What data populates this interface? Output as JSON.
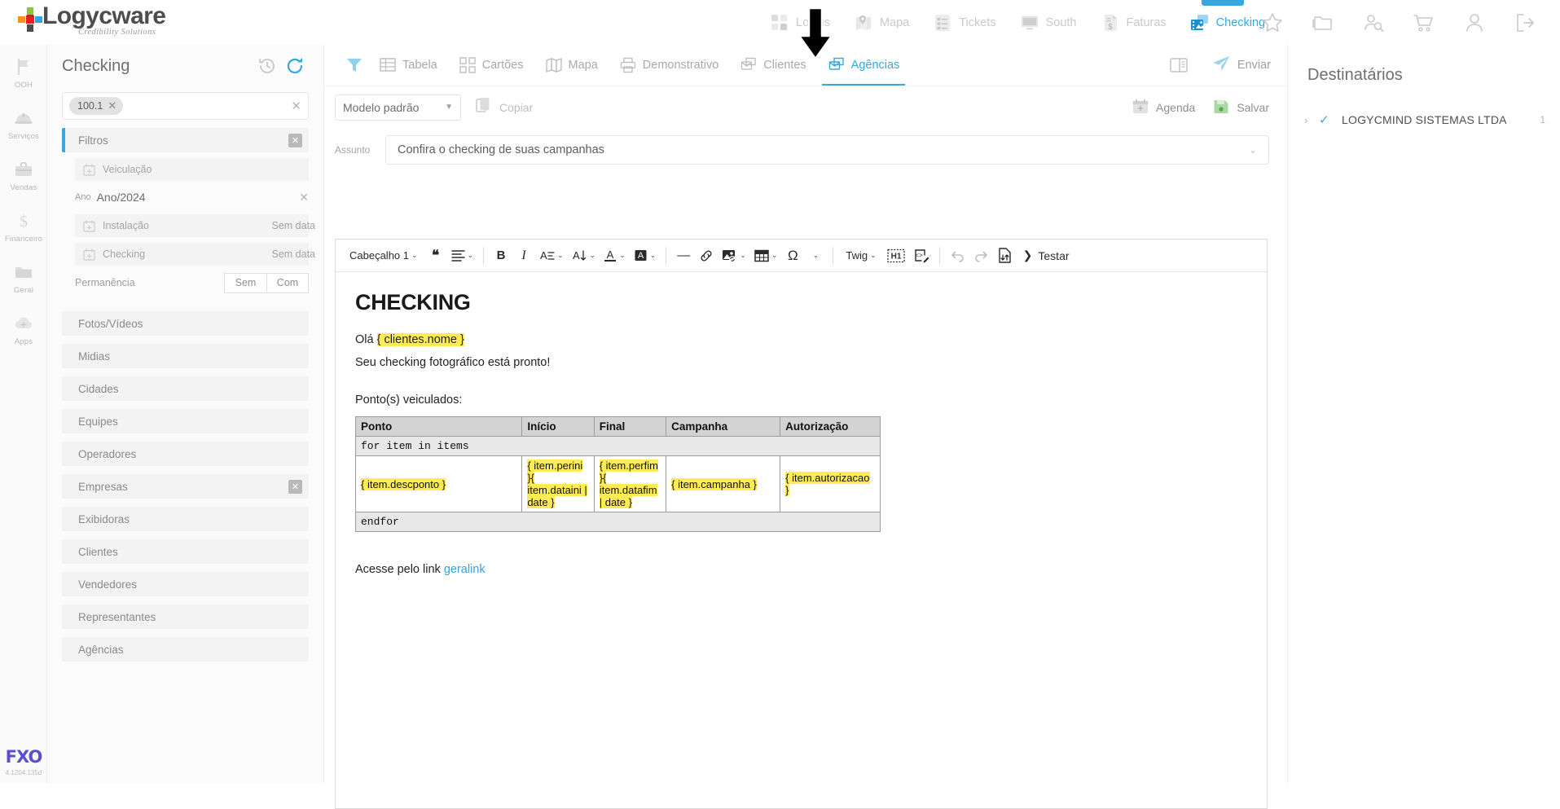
{
  "brand": {
    "name": "Logycware",
    "tagline": "Credibility Solutions"
  },
  "topnav": {
    "items": [
      {
        "label": "Locais",
        "icon": "grid-squares-icon",
        "active": false
      },
      {
        "label": "Mapa",
        "icon": "map-pin-icon",
        "active": false
      },
      {
        "label": "Tickets",
        "icon": "checklist-icon",
        "active": false
      },
      {
        "label": "South",
        "icon": "monitor-icon",
        "active": false
      },
      {
        "label": "Faturas",
        "icon": "invoice-dollar-icon",
        "active": false
      },
      {
        "label": "Checking",
        "icon": "photo-film-icon",
        "active": true
      }
    ],
    "icons": [
      {
        "name": "star-icon"
      },
      {
        "name": "folder-icon"
      },
      {
        "name": "user-search-icon"
      },
      {
        "name": "cart-icon"
      },
      {
        "name": "user-icon"
      },
      {
        "name": "logout-icon"
      }
    ]
  },
  "rail": {
    "items": [
      {
        "label": "OOH",
        "icon": "flag-icon"
      },
      {
        "label": "Serviços",
        "icon": "helmet-icon"
      },
      {
        "label": "Vendas",
        "icon": "briefcase-icon"
      },
      {
        "label": "Financeiro",
        "icon": "dollar-icon"
      },
      {
        "label": "Geral",
        "icon": "folder-icon"
      },
      {
        "label": "Apps",
        "icon": "cloud-plus-icon"
      }
    ],
    "app_logo": "FXO",
    "version": "4.1204.135d"
  },
  "left_panel": {
    "title": "Checking",
    "history_icon": "history-clock-icon",
    "refresh_icon": "refresh-icon",
    "search_chip": "100.1",
    "search_clear": "✕",
    "filters_section": {
      "label": "Filtros",
      "close": "✕"
    },
    "veiculacao": {
      "label": "Veiculação"
    },
    "ano": {
      "key": "Ano",
      "value": "Ano/2024",
      "clear": "✕"
    },
    "instalacao": {
      "label": "Instalação",
      "value": "Sem data"
    },
    "checking": {
      "label": "Checking",
      "value": "Sem data"
    },
    "permanencia": {
      "label": "Permanência",
      "option_sem": "Sem",
      "option_com": "Com"
    },
    "sections": [
      {
        "label": "Fotos/Vídeos",
        "has_close": false
      },
      {
        "label": "Midias",
        "has_close": false
      },
      {
        "label": "Cidades",
        "has_close": false
      },
      {
        "label": "Equipes",
        "has_close": false
      },
      {
        "label": "Operadores",
        "has_close": false
      },
      {
        "label": "Empresas",
        "has_close": true
      },
      {
        "label": "Exibidoras",
        "has_close": false
      },
      {
        "label": "Clientes",
        "has_close": false
      },
      {
        "label": "Vendedores",
        "has_close": false
      },
      {
        "label": "Representantes",
        "has_close": false
      },
      {
        "label": "Agências",
        "has_close": false
      }
    ]
  },
  "main": {
    "filter_icon": "funnel-icon",
    "tabs": [
      {
        "label": "Tabela",
        "icon": "table-icon",
        "active": false
      },
      {
        "label": "Cartões",
        "icon": "cards-icon",
        "active": false
      },
      {
        "label": "Mapa",
        "icon": "map-icon",
        "active": false
      },
      {
        "label": "Demonstrativo",
        "icon": "printer-icon",
        "active": false
      },
      {
        "label": "Clientes",
        "icon": "mail-stack-icon",
        "active": false
      },
      {
        "label": "Agências",
        "icon": "mail-stack-icon",
        "active": true
      }
    ],
    "layout_icon": "split-layout-icon",
    "send_label": "Enviar",
    "send_icon": "paper-plane-icon",
    "model_select": "Modelo padrão",
    "copy_label": "Copiar",
    "agenda_label": "Agenda",
    "salvar_label": "Salvar",
    "subject_label": "Assunto",
    "subject_value": "Confira o checking de suas campanhas"
  },
  "editor_toolbar": {
    "heading": "Cabeçalho 1",
    "quote": "❝",
    "align": "align-icon",
    "bold": "B",
    "italic": "I",
    "font_family": "A",
    "font_size": "A",
    "text_color": "A",
    "bg_color": "A",
    "hr": "—",
    "link": "link-icon",
    "image": "image-icon",
    "table": "table-icon",
    "symbol": "Ω",
    "twig": "Twig",
    "h1_block": "H1",
    "source": "source-code-icon",
    "undo": "undo-icon",
    "redo": "redo-icon",
    "import": "import-export-icon",
    "test": "Testar"
  },
  "document": {
    "title": "CHECKING",
    "greeting_prefix": "Olá ",
    "greeting_var": "{ clientes.nome }",
    "line2": "Seu checking fotográfico está pronto!",
    "points_label": "Ponto(s) veiculados:",
    "table": {
      "headers": [
        "Ponto",
        "Início",
        "Final",
        "Campanha",
        "Autorização"
      ],
      "for_line": "for item in items",
      "endfor_line": "endfor",
      "row": {
        "ponto": "{ item.descponto }",
        "inicio": "{ item.perini }{ item.dataini | date }",
        "final": "{ item.perfim }{ item.datafim | date }",
        "campanha": "{ item.campanha }",
        "autorizacao": "{ item.autorizacao }"
      }
    },
    "footer_prefix": "Acesse pelo link ",
    "footer_link": "geralink"
  },
  "right_panel": {
    "title": "Destinatários",
    "recipients": [
      {
        "expand": "›",
        "check": "✓",
        "name": "LOGYCMIND SISTEMAS LTDA",
        "count": "1"
      }
    ]
  },
  "colors": {
    "accent": "#35a8e0",
    "highlight": "#ffec54",
    "save_green": "#7ec37e"
  }
}
